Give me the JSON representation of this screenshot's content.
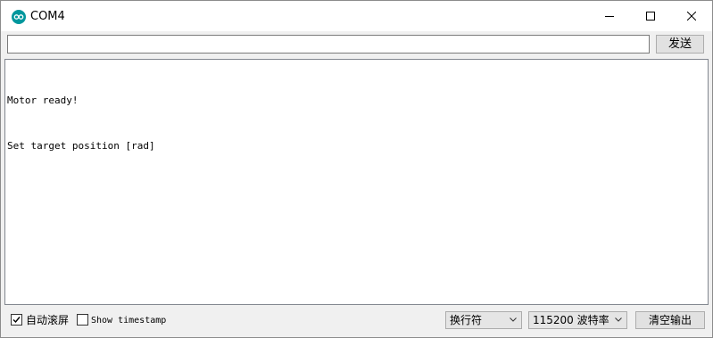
{
  "window": {
    "title": "COM4",
    "accent_color": "#00979d",
    "icons": [
      "arduino-logo-icon",
      "minimize-icon",
      "maximize-icon",
      "close-icon"
    ]
  },
  "input_bar": {
    "value": "",
    "send_label": "发送"
  },
  "output": {
    "lines": [
      "Motor ready!",
      "Set target position [rad]"
    ]
  },
  "bottom_bar": {
    "autoscroll_label": "自动滚屏",
    "autoscroll_checked": true,
    "timestamp_label": "Show timestamp",
    "timestamp_checked": false,
    "line_ending": "换行符",
    "baud_rate": "115200 波特率",
    "clear_label": "清空输出"
  }
}
